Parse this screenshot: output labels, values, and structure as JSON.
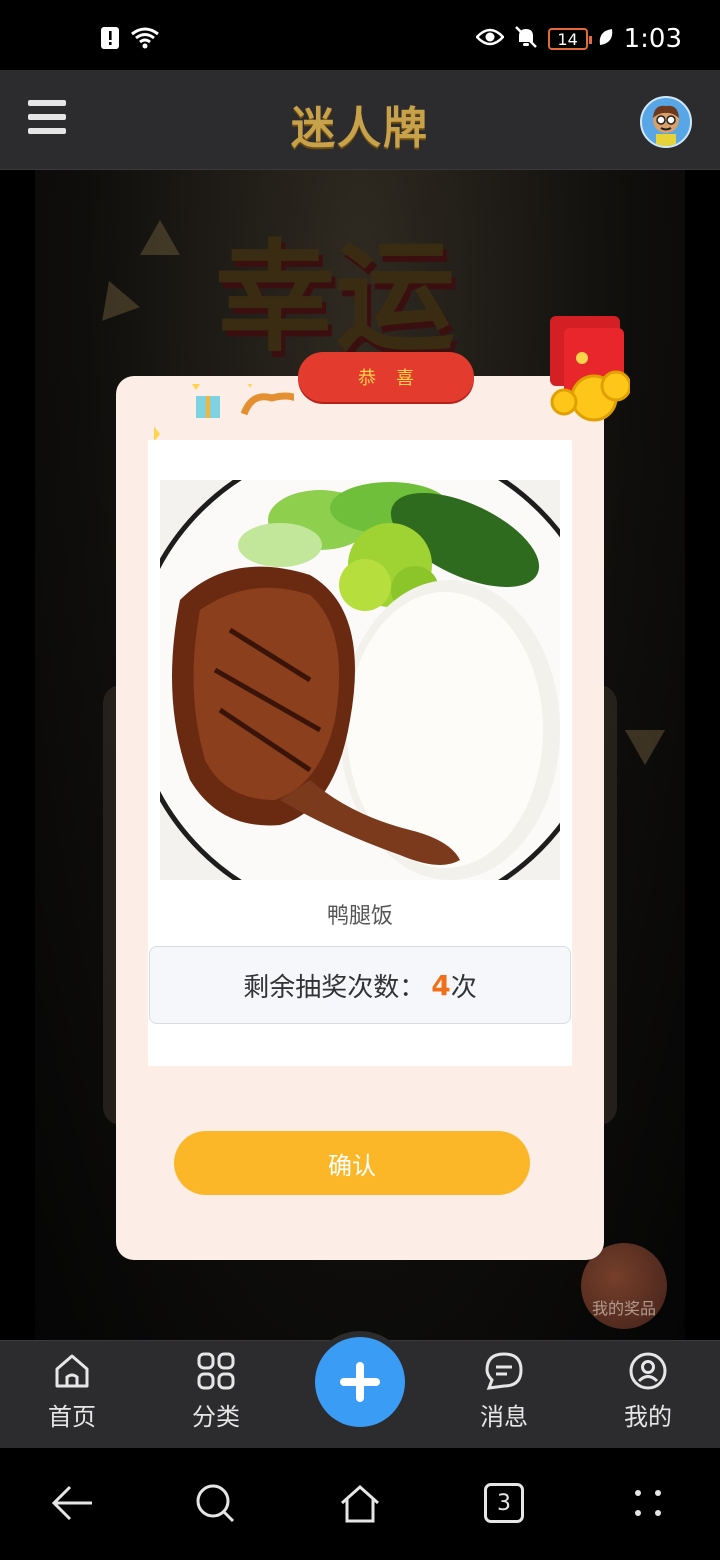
{
  "status_bar": {
    "time": "1:03",
    "battery_level": "14",
    "icons": [
      "alert-icon",
      "wifi-icon",
      "eye-icon",
      "mute-bell-icon",
      "battery-icon",
      "leaf-icon"
    ]
  },
  "header": {
    "title": "迷人牌",
    "menu_icon": "hamburger-icon",
    "avatar_icon": "avatar"
  },
  "background": {
    "banner_text": "幸运",
    "floating_prize_label": "我的奖品"
  },
  "modal": {
    "ribbon_text": "恭喜",
    "dish_name": "鸭腿饭",
    "remaining_label": "剩余抽奖次数：",
    "remaining_count": "4",
    "remaining_unit": "次",
    "confirm_label": "确认"
  },
  "bottom_nav": {
    "items": [
      {
        "label": "首页",
        "icon": "home-icon"
      },
      {
        "label": "分类",
        "icon": "grid-icon"
      },
      {
        "label": "",
        "icon": "plus-icon"
      },
      {
        "label": "消息",
        "icon": "message-icon"
      },
      {
        "label": "我的",
        "icon": "profile-icon"
      }
    ]
  },
  "system_nav": {
    "tabs_count": "3",
    "icons": [
      "back-icon",
      "search-icon",
      "home-icon",
      "tabs-icon",
      "more-icon"
    ]
  },
  "colors": {
    "accent_orange": "#f26f1a",
    "confirm_yellow": "#fbb728",
    "ribbon_red": "#e33b2e",
    "plus_blue": "#3b9cf5",
    "modal_bg": "#fcede6"
  }
}
